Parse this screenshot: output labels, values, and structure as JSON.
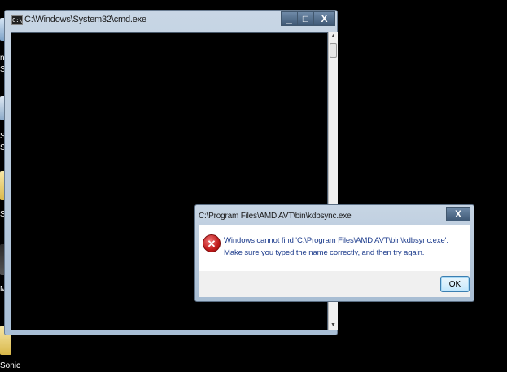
{
  "desktop": {
    "labels": [
      "n",
      "Sl",
      "So",
      "Sl",
      "Sp",
      "Mi",
      "Sonic"
    ]
  },
  "cmd_window": {
    "icon_text": "C:\\",
    "title": "C:\\Windows\\System32\\cmd.exe",
    "minimize": "_",
    "maximize": "□",
    "close": "X",
    "scroll_up": "▲",
    "scroll_down": "▼"
  },
  "error_dialog": {
    "title": "C:\\Program Files\\AMD AVT\\bin\\kdbsync.exe",
    "close": "X",
    "icon_glyph": "✕",
    "message": "Windows cannot find 'C:\\Program Files\\AMD AVT\\bin\\kdbsync.exe'. Make sure you typed the name correctly, and then try again.",
    "ok_label": "OK"
  },
  "colors": {
    "desktop_background": "#000000",
    "console_background": "#000000",
    "message_text": "#1c3b8c",
    "error_red": "#c21b1b"
  }
}
